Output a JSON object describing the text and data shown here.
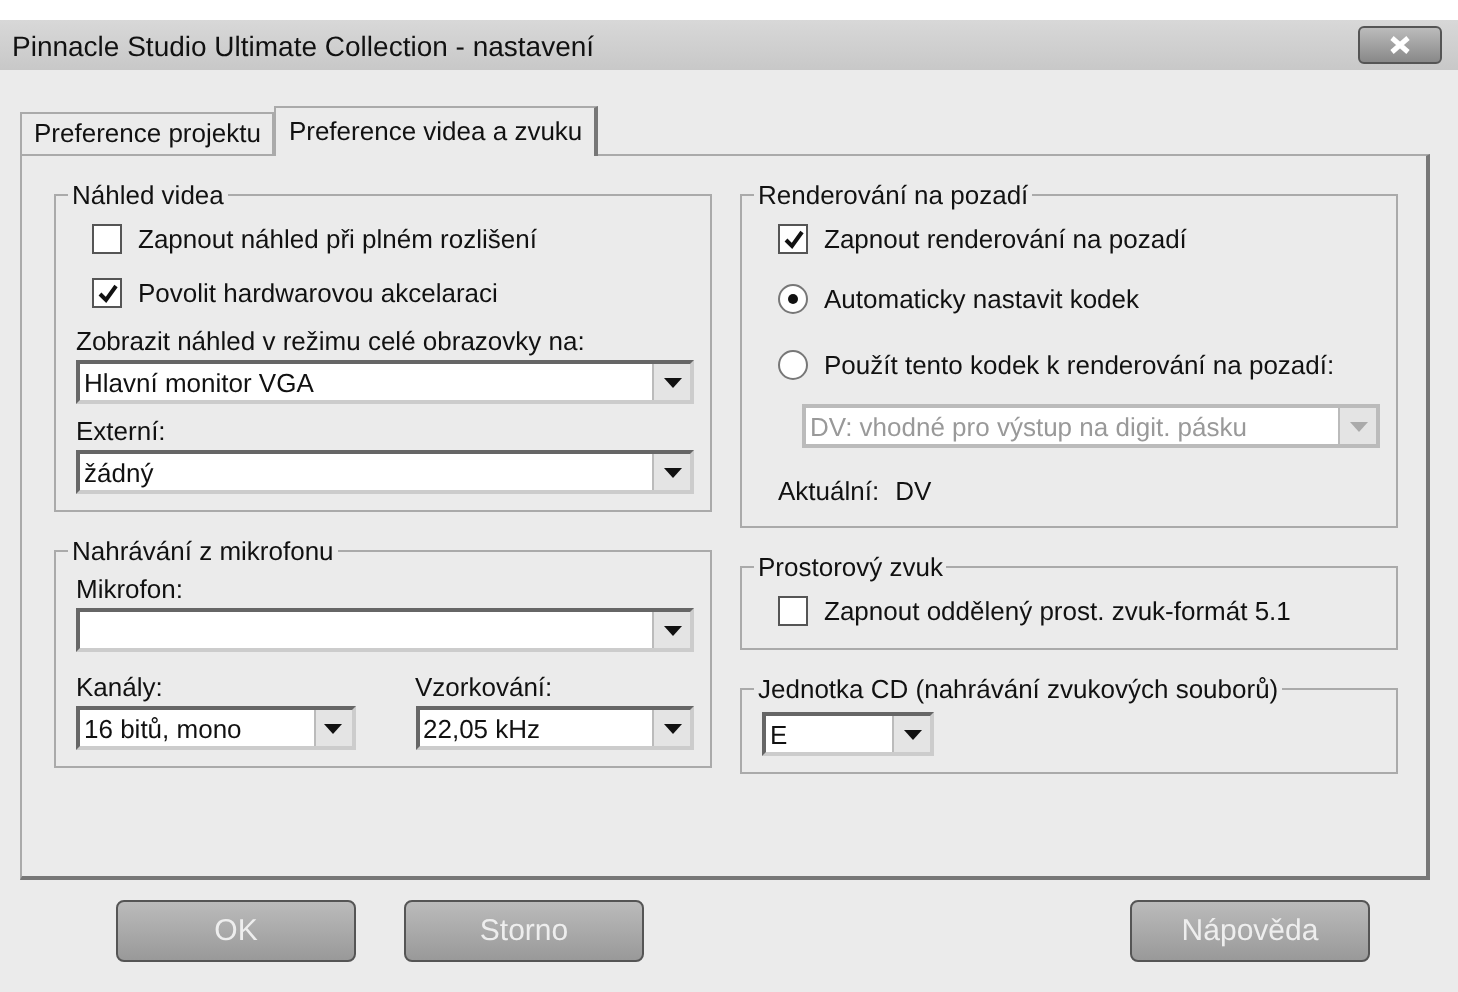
{
  "window": {
    "title": "Pinnacle Studio Ultimate Collection - nastavení"
  },
  "tabs": [
    {
      "label": "Preference projektu",
      "selected": false
    },
    {
      "label": "Preference videa a zvuku",
      "selected": true
    }
  ],
  "left_groups": [
    {
      "title": "Náhled videa",
      "controls": [
        {
          "kind": "checkbox",
          "label": "Zapnout náhled při plném rozlišení",
          "checked": false
        },
        {
          "kind": "checkbox",
          "label": "Povolit hardwarovou akcelaraci",
          "checked": true
        },
        {
          "kind": "select",
          "label": "Zobrazit náhled v režimu celé obrazovky na:",
          "value": "Hlavní monitor VGA",
          "wide": true,
          "disabled": false
        },
        {
          "kind": "select",
          "label": "Externí:",
          "value": "žádný",
          "wide": true,
          "disabled": false
        }
      ]
    },
    {
      "title": "Nahrávání z mikrofonu",
      "controls": [
        {
          "kind": "select",
          "label": "Mikrofon:",
          "wide": true,
          "disabled": false
        },
        {
          "kind": "pair",
          "fields": [
            {
              "label": "Kanály:",
              "value": "16 bitů, mono"
            },
            {
              "label": "Vzorkování:",
              "value": "22,05 kHz"
            }
          ]
        }
      ]
    }
  ],
  "right_groups": [
    {
      "title": "Renderování na pozadí",
      "controls": [
        {
          "kind": "checkbox",
          "label": "Zapnout renderování na pozadí",
          "checked": true
        },
        {
          "kind": "radio",
          "label": "Automaticky nastavit kodek",
          "selected": true
        },
        {
          "kind": "radio",
          "label": "Použít tento kodek k renderování na pozadí:",
          "selected": false
        },
        {
          "kind": "select",
          "value": "DV: vhodné pro výstup na digit. pásku",
          "wide": false,
          "disabled": true
        },
        {
          "kind": "info",
          "label": "Aktuální:",
          "value": "DV"
        }
      ]
    },
    {
      "title": "Prostorový zvuk",
      "controls": [
        {
          "kind": "checkbox",
          "label": "Zapnout oddělený prost. zvuk-formát 5.1",
          "checked": false
        }
      ]
    },
    {
      "title": "Jednotka CD (nahrávání zvukových souborů)",
      "controls": [
        {
          "kind": "select",
          "value": "E",
          "short": true,
          "disabled": false
        }
      ]
    }
  ],
  "buttons": [
    {
      "label": "OK",
      "kind": "main"
    },
    {
      "label": "Storno",
      "kind": "main"
    },
    {
      "label": "Nápověda",
      "kind": "help"
    }
  ]
}
